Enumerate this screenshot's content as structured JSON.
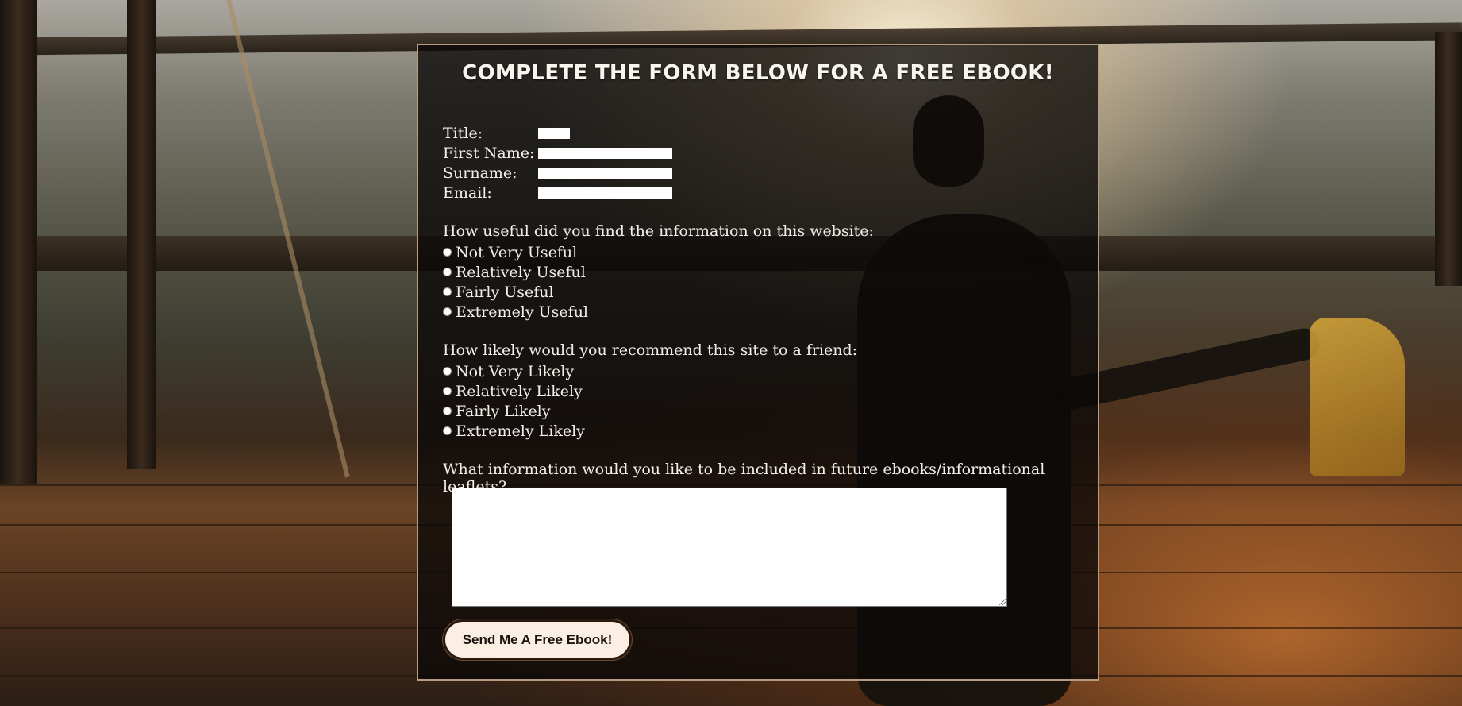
{
  "form": {
    "title": "COMPLETE THE FORM BELOW FOR A FREE EBOOK!",
    "fields": {
      "title_label": "Title:",
      "first_name_label": "First Name:",
      "surname_label": "Surname:",
      "email_label": "Email:",
      "title_value": "",
      "first_name_value": "",
      "surname_value": "",
      "email_value": ""
    },
    "usefulness": {
      "question": "How useful did you find the information on this website:",
      "options": [
        "Not Very Useful",
        "Relatively Useful",
        "Fairly Useful",
        "Extremely Useful"
      ]
    },
    "recommend": {
      "question": "How likely would you recommend this site to a friend:",
      "options": [
        "Not Very Likely",
        "Relatively Likely",
        "Fairly Likely",
        "Extremely Likely"
      ]
    },
    "future_info": {
      "question": "What information would you like to be included in future ebooks/informational leaflets?",
      "value": ""
    },
    "submit_label": "Send Me A Free Ebook!"
  },
  "colors": {
    "panel_border": "#b79c82",
    "button_bg": "#fbeee3",
    "text": "#f2eee8"
  }
}
